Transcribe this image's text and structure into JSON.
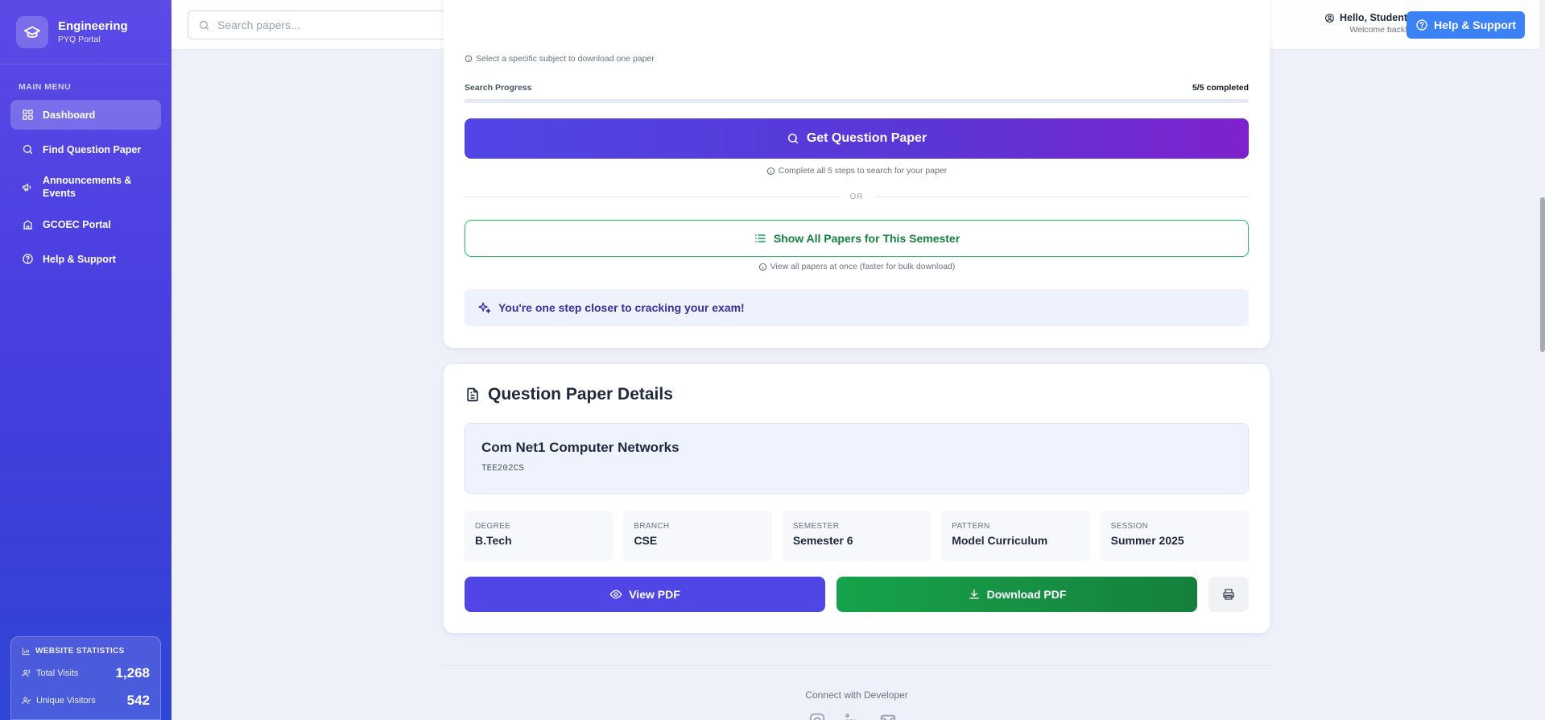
{
  "brand": {
    "title": "Engineering",
    "subtitle": "PYQ Portal"
  },
  "sidebar": {
    "menu_heading": "MAIN MENU",
    "items": [
      {
        "label": "Dashboard",
        "icon": "grid-icon",
        "active": true
      },
      {
        "label": "Find Question Paper",
        "icon": "search-icon"
      },
      {
        "label": "Announcements & Events",
        "icon": "megaphone-icon"
      },
      {
        "label": "GCOEC Portal",
        "icon": "school-icon"
      },
      {
        "label": "Help & Support",
        "icon": "help-circle-icon"
      }
    ],
    "stats": {
      "title": "WEBSITE STATISTICS",
      "total_visits_label": "Total Visits",
      "total_visits": "1,268",
      "unique_visitors_label": "Unique Visitors",
      "unique_visitors": "542"
    }
  },
  "header": {
    "search_placeholder": "Search papers...",
    "greeting": "Hello, Student",
    "welcome": "Welcome back!",
    "help_button": "Help & Support"
  },
  "search_card": {
    "subject_hint": "Select a specific subject to download one paper",
    "progress_label": "Search Progress",
    "progress_text": "5/5 completed",
    "progress_fraction": 1.0,
    "get_button": "Get Question Paper",
    "steps_hint": "Complete all 5 steps to search for your paper",
    "or_text": "OR",
    "show_all_button": "Show All Papers for This Semester",
    "show_all_hint": "View all papers at once (faster for bulk download)",
    "motto": "You're one step closer to cracking your exam!"
  },
  "details_card": {
    "title": "Question Paper Details",
    "subject_name": "Com Net1 Computer Networks",
    "subject_code": "TEE202CS",
    "info": [
      {
        "label": "DEGREE",
        "value": "B.Tech"
      },
      {
        "label": "BRANCH",
        "value": "CSE"
      },
      {
        "label": "SEMESTER",
        "value": "Semester 6"
      },
      {
        "label": "PATTERN",
        "value": "Model Curriculum"
      },
      {
        "label": "SESSION",
        "value": "Summer 2025"
      }
    ],
    "view_button": "View PDF",
    "download_button": "Download PDF"
  },
  "footer": {
    "connect_text": "Connect with Developer"
  },
  "colors": {
    "sidebar": "#4a3fe0",
    "primary": "#4f46e5",
    "success": "#16a34a",
    "help": "#3b82f6"
  }
}
